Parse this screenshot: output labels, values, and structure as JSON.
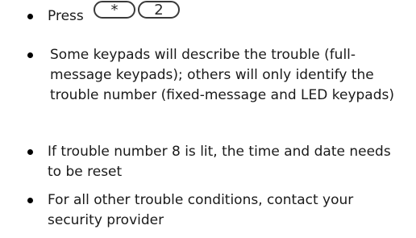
{
  "items": [
    {
      "text": "Press"
    },
    {
      "text": "Some keypads will describe the trouble (full-message keypads); others will only identify the trouble number (fixed-message and LED keypads)"
    },
    {
      "text": "If trouble number 8 is lit, the time and date needs to be reset"
    },
    {
      "text": "For all other trouble conditions, contact your security provider"
    }
  ],
  "keys": [
    "*",
    "2"
  ]
}
